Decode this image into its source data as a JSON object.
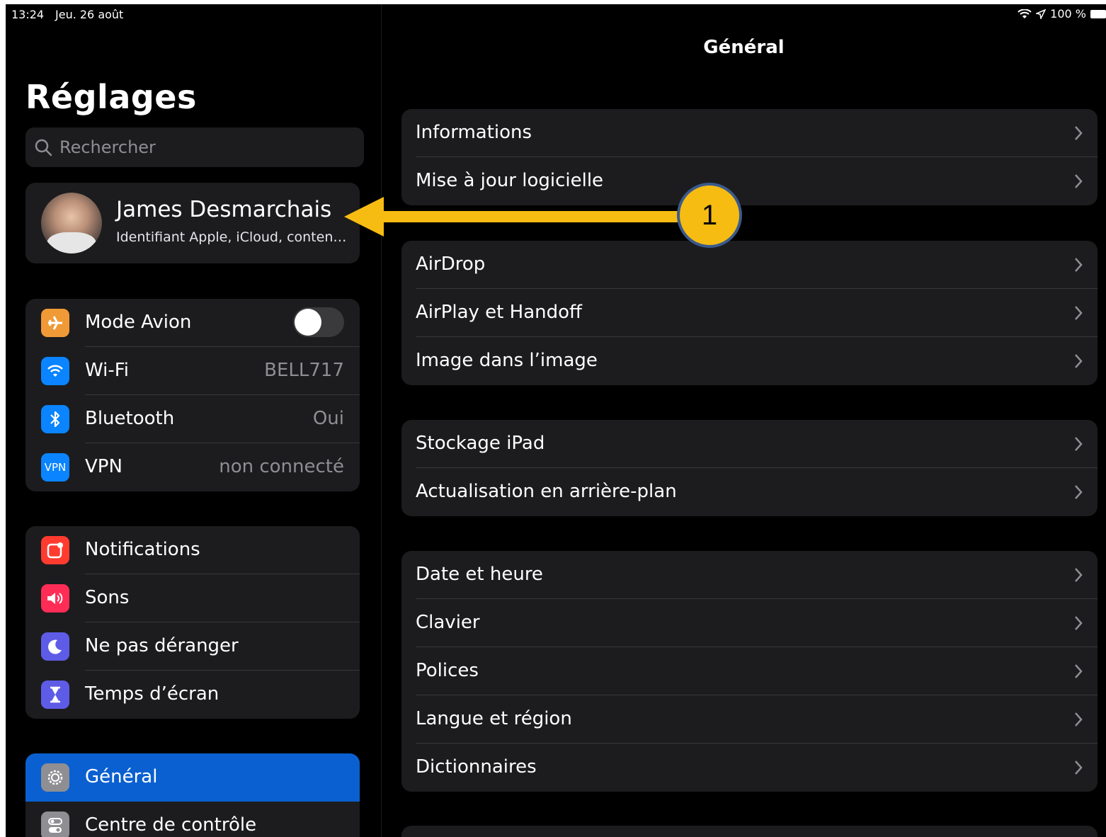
{
  "status_bar": {
    "time": "13:24",
    "date": "Jeu. 26 août",
    "battery": "100 %"
  },
  "sidebar": {
    "title": "Réglages",
    "search_placeholder": "Rechercher",
    "profile": {
      "name": "James Desmarchais",
      "subtitle": "Identifiant Apple, iCloud, conten…"
    },
    "group1": [
      {
        "label": "Mode Avion",
        "icon": "airplane-icon",
        "color": "#f09a37",
        "toggle": false
      },
      {
        "label": "Wi-Fi",
        "value": "BELL717",
        "icon": "wifi-icon",
        "color": "#0a84ff"
      },
      {
        "label": "Bluetooth",
        "value": "Oui",
        "icon": "bluetooth-icon",
        "color": "#0a84ff"
      },
      {
        "label": "VPN",
        "value": "non connecté",
        "icon": "vpn-icon",
        "icon_text": "VPN",
        "color": "#0a84ff"
      }
    ],
    "group2": [
      {
        "label": "Notifications",
        "icon": "notifications-icon",
        "color": "#ff3b30"
      },
      {
        "label": "Sons",
        "icon": "sound-icon",
        "color": "#ff2d55"
      },
      {
        "label": "Ne pas déranger",
        "icon": "moon-icon",
        "color": "#5e5ce6"
      },
      {
        "label": "Temps d’écran",
        "icon": "hourglass-icon",
        "color": "#5e5ce6"
      }
    ],
    "group3": [
      {
        "label": "Général",
        "icon": "gear-icon",
        "color": "#8e8e93",
        "selected": true
      },
      {
        "label": "Centre de contrôle",
        "icon": "control-center-icon",
        "color": "#8e8e93"
      }
    ]
  },
  "detail": {
    "title": "Général",
    "groups": [
      [
        "Informations",
        "Mise à jour logicielle"
      ],
      [
        "AirDrop",
        "AirPlay et Handoff",
        "Image dans l’image"
      ],
      [
        "Stockage iPad",
        "Actualisation en arrière-plan"
      ],
      [
        "Date et heure",
        "Clavier",
        "Polices",
        "Langue et région",
        "Dictionnaires"
      ]
    ]
  },
  "annotation": {
    "number": "1",
    "color": "#f6bc11"
  }
}
